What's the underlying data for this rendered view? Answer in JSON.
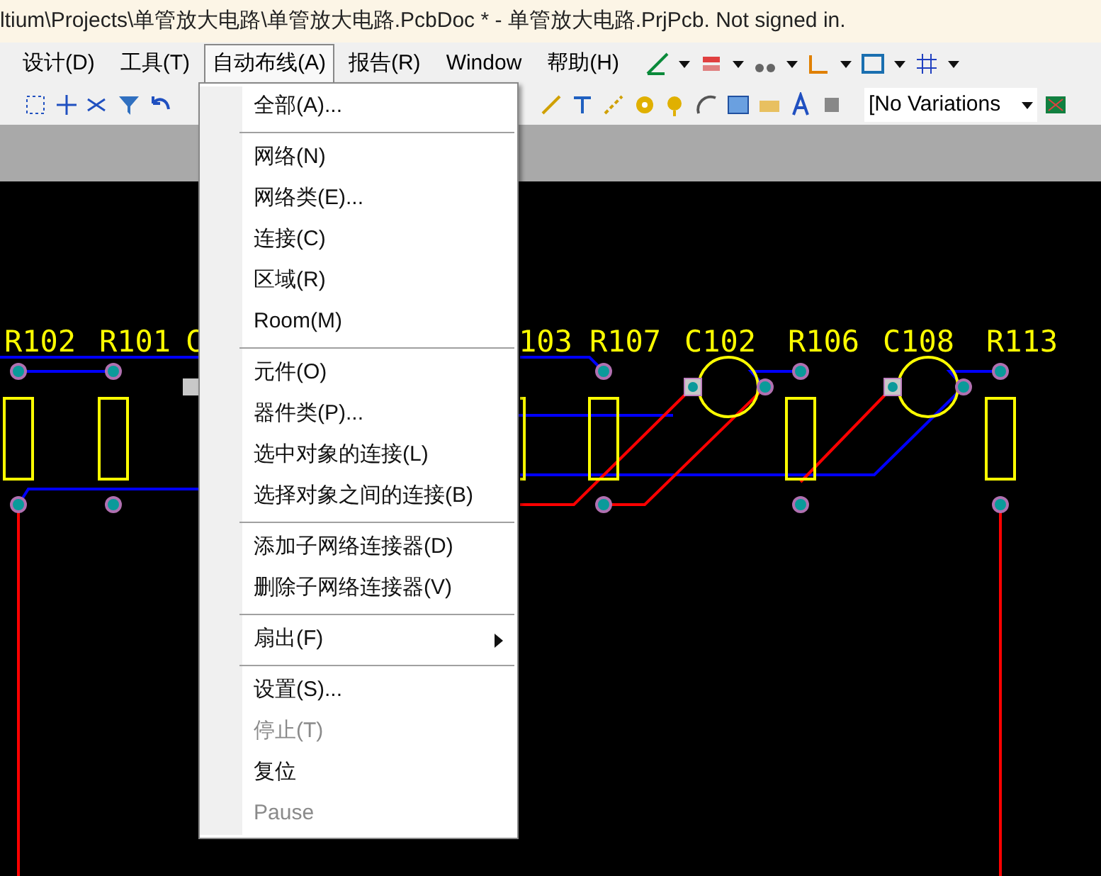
{
  "window": {
    "title": "ltium\\Projects\\单管放大电路\\单管放大电路.PcbDoc * - 单管放大电路.PrjPcb. Not signed in."
  },
  "menubar": [
    {
      "label": "设计(D)",
      "selected": false
    },
    {
      "label": "工具(T)",
      "selected": false
    },
    {
      "label": "自动布线(A)",
      "selected": true
    },
    {
      "label": "报告(R)",
      "selected": false
    },
    {
      "label": "Window",
      "selected": false
    },
    {
      "label": "帮助(H)",
      "selected": false
    }
  ],
  "variant_dropdown": {
    "value": "[No Variations"
  },
  "pcb": {
    "designators": [
      "R102",
      "R101",
      "C",
      "103",
      "R107",
      "C102",
      "R106",
      "C108",
      "R113"
    ]
  },
  "menu": [
    {
      "kind": "item",
      "label": "全部(A)...",
      "disabled": false,
      "submenu": false
    },
    {
      "kind": "separator"
    },
    {
      "kind": "item",
      "label": "网络(N)",
      "disabled": false,
      "submenu": false
    },
    {
      "kind": "item",
      "label": "网络类(E)...",
      "disabled": false,
      "submenu": false
    },
    {
      "kind": "item",
      "label": "连接(C)",
      "disabled": false,
      "submenu": false
    },
    {
      "kind": "item",
      "label": "区域(R)",
      "disabled": false,
      "submenu": false
    },
    {
      "kind": "item",
      "label": "Room(M)",
      "disabled": false,
      "submenu": false
    },
    {
      "kind": "separator"
    },
    {
      "kind": "item",
      "label": "元件(O)",
      "disabled": false,
      "submenu": false
    },
    {
      "kind": "item",
      "label": "器件类(P)...",
      "disabled": false,
      "submenu": false
    },
    {
      "kind": "item",
      "label": "选中对象的连接(L)",
      "disabled": false,
      "submenu": false
    },
    {
      "kind": "item",
      "label": "选择对象之间的连接(B)",
      "disabled": false,
      "submenu": false
    },
    {
      "kind": "separator"
    },
    {
      "kind": "item",
      "label": "添加子网络连接器(D)",
      "disabled": false,
      "submenu": false
    },
    {
      "kind": "item",
      "label": "删除子网络连接器(V)",
      "disabled": false,
      "submenu": false
    },
    {
      "kind": "separator"
    },
    {
      "kind": "item",
      "label": "扇出(F)",
      "disabled": false,
      "submenu": true
    },
    {
      "kind": "separator"
    },
    {
      "kind": "item",
      "label": "设置(S)...",
      "disabled": false,
      "submenu": false
    },
    {
      "kind": "item",
      "label": "停止(T)",
      "disabled": true,
      "submenu": false
    },
    {
      "kind": "item",
      "label": "复位",
      "disabled": false,
      "submenu": false
    },
    {
      "kind": "item",
      "label": "Pause",
      "disabled": true,
      "submenu": false
    }
  ]
}
